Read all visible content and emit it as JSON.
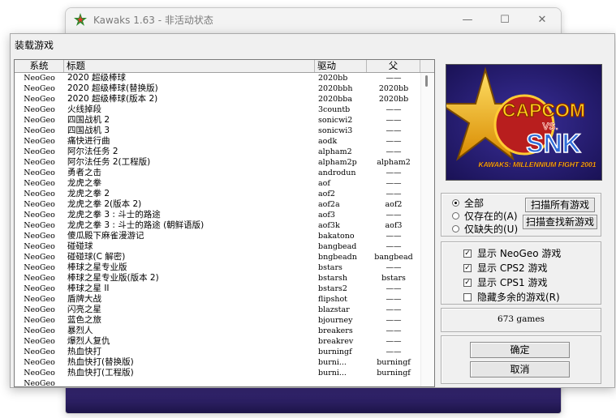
{
  "background_window": {
    "title": "Kawaks 1.63 - 非活动状态",
    "minimize_glyph": "—",
    "maximize_glyph": "☐",
    "close_glyph": "✕"
  },
  "dialog": {
    "title": "装载游戏"
  },
  "list": {
    "headers": {
      "system": "系统",
      "title": "标题",
      "driver": "驱动",
      "parent": "父"
    },
    "rows": [
      {
        "system": "NeoGeo",
        "title": "2020 超级棒球",
        "driver": "2020bb",
        "parent": "——"
      },
      {
        "system": "NeoGeo",
        "title": "2020 超级棒球(替换版)",
        "driver": "2020bbh",
        "parent": "2020bb"
      },
      {
        "system": "NeoGeo",
        "title": "2020 超级棒球(版本 2)",
        "driver": "2020bba",
        "parent": "2020bb"
      },
      {
        "system": "NeoGeo",
        "title": "火线掉段",
        "driver": "3countb",
        "parent": "——"
      },
      {
        "system": "NeoGeo",
        "title": "四国战机 2",
        "driver": "sonicwi2",
        "parent": "——"
      },
      {
        "system": "NeoGeo",
        "title": "四国战机 3",
        "driver": "sonicwi3",
        "parent": "——"
      },
      {
        "system": "NeoGeo",
        "title": "痛快进行曲",
        "driver": "aodk",
        "parent": "——"
      },
      {
        "system": "NeoGeo",
        "title": "阿尔法任务 2",
        "driver": "alpham2",
        "parent": "——"
      },
      {
        "system": "NeoGeo",
        "title": "阿尔法任务 2(工程版)",
        "driver": "alpham2p",
        "parent": "alpham2"
      },
      {
        "system": "NeoGeo",
        "title": "勇者之击",
        "driver": "androdun",
        "parent": "——"
      },
      {
        "system": "NeoGeo",
        "title": "龙虎之拳",
        "driver": "aof",
        "parent": "——"
      },
      {
        "system": "NeoGeo",
        "title": "龙虎之拳 2",
        "driver": "aof2",
        "parent": "——"
      },
      {
        "system": "NeoGeo",
        "title": "龙虎之拳 2(版本 2)",
        "driver": "aof2a",
        "parent": "aof2"
      },
      {
        "system": "NeoGeo",
        "title": "龙虎之拳 3 : 斗士的路途",
        "driver": "aof3",
        "parent": "——"
      },
      {
        "system": "NeoGeo",
        "title": "龙虎之拳 3 : 斗士的路途 (朝鲜语版)",
        "driver": "aof3k",
        "parent": "aof3"
      },
      {
        "system": "NeoGeo",
        "title": "傻瓜殿下麻雀漫游记",
        "driver": "bakatono",
        "parent": "——"
      },
      {
        "system": "NeoGeo",
        "title": "碰碰球",
        "driver": "bangbead",
        "parent": "——"
      },
      {
        "system": "NeoGeo",
        "title": "碰碰球(C 解密)",
        "driver": "bngbeadn",
        "parent": "bangbead"
      },
      {
        "system": "NeoGeo",
        "title": "棒球之星专业版",
        "driver": "bstars",
        "parent": "——"
      },
      {
        "system": "NeoGeo",
        "title": "棒球之星专业版(版本 2)",
        "driver": "bstarsh",
        "parent": "bstars"
      },
      {
        "system": "NeoGeo",
        "title": "棒球之星 II",
        "driver": "bstars2",
        "parent": "——"
      },
      {
        "system": "NeoGeo",
        "title": "盾牌大战",
        "driver": "flipshot",
        "parent": "——"
      },
      {
        "system": "NeoGeo",
        "title": "闪亮之星",
        "driver": "blazstar",
        "parent": "——"
      },
      {
        "system": "NeoGeo",
        "title": "蓝色之旅",
        "driver": "bjourney",
        "parent": "——"
      },
      {
        "system": "NeoGeo",
        "title": "暴烈人",
        "driver": "breakers",
        "parent": "——"
      },
      {
        "system": "NeoGeo",
        "title": "爆烈人复仇",
        "driver": "breakrev",
        "parent": "——"
      },
      {
        "system": "NeoGeo",
        "title": "热血快打",
        "driver": "burningf",
        "parent": "——"
      },
      {
        "system": "NeoGeo",
        "title": "热血快打(替换版)",
        "driver": "burni...",
        "parent": "burningf"
      },
      {
        "system": "NeoGeo",
        "title": "热血快打(工程版)",
        "driver": "burni...",
        "parent": "burningf"
      },
      {
        "system": "NeoGeo",
        "title": "",
        "driver": "",
        "parent": ""
      }
    ]
  },
  "logo": {
    "line1": "CAPCOM",
    "vs": "VS.",
    "line2": "SNK",
    "subtitle": "KAWAKS: MILLENNIUM FIGHT 2001"
  },
  "filter_radios": [
    {
      "label": "全部",
      "checked": true
    },
    {
      "label": "仅存在的(A)",
      "checked": false
    },
    {
      "label": "仅缺失的(U)",
      "checked": false
    }
  ],
  "scan_buttons": {
    "scan_all": "扫描所有游戏",
    "scan_new": "扫描查找新游戏"
  },
  "system_checks": [
    {
      "label": "显示 NeoGeo 游戏",
      "checked": true
    },
    {
      "label": "显示 CPS2 游戏",
      "checked": true
    },
    {
      "label": "显示 CPS1 游戏",
      "checked": true
    },
    {
      "label": "隐藏多余的游戏(R)",
      "checked": false
    }
  ],
  "count": "673 games",
  "actions": {
    "ok": "确定",
    "cancel": "取消"
  },
  "colors": {
    "logo_bg": "#2a1f72",
    "star_gold": "#f0b000",
    "capcom_yellow": "#ffd21a",
    "snk_blue": "#2d6cd8",
    "vs_red": "#d62a1a"
  },
  "icons": {
    "check_mark": "✓"
  }
}
